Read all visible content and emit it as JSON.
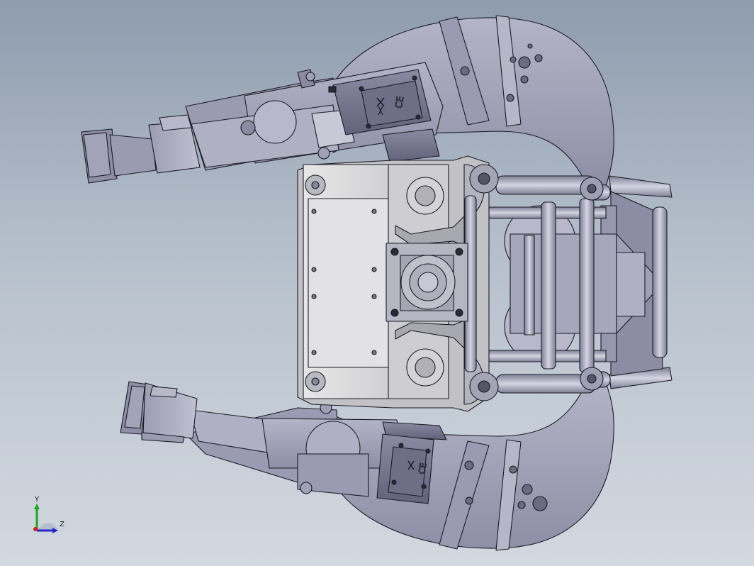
{
  "scene": {
    "background_top": "#8e9cae",
    "background_bottom": "#d2d8df",
    "part_fill": "#a6a6bc",
    "part_fill_dark": "#7c7c94",
    "part_fill_light": "#c4c4d4",
    "plate_fill": "#d8d8d8",
    "edge_color": "#1a1a24"
  },
  "triad": {
    "y_label": "Y",
    "z_label": "Z",
    "y_color": "#1fa51f",
    "z_color": "#2727c8",
    "x_color": "#d21f1f"
  },
  "components": {
    "upper_ring": "upper-ring-bracket",
    "lower_ring": "lower-ring-bracket",
    "upper_arm": "upper-arm-assembly",
    "lower_arm": "lower-arm-assembly",
    "upper_gripper": "upper-gripper-tip",
    "lower_gripper": "lower-gripper-tip",
    "upper_servo": "upper-servo-with-markings",
    "lower_servo": "lower-servo-with-markings",
    "center_plate": "center-mounting-plate",
    "center_hub": "center-hub-flange",
    "right_frame": "right-tube-frame"
  }
}
